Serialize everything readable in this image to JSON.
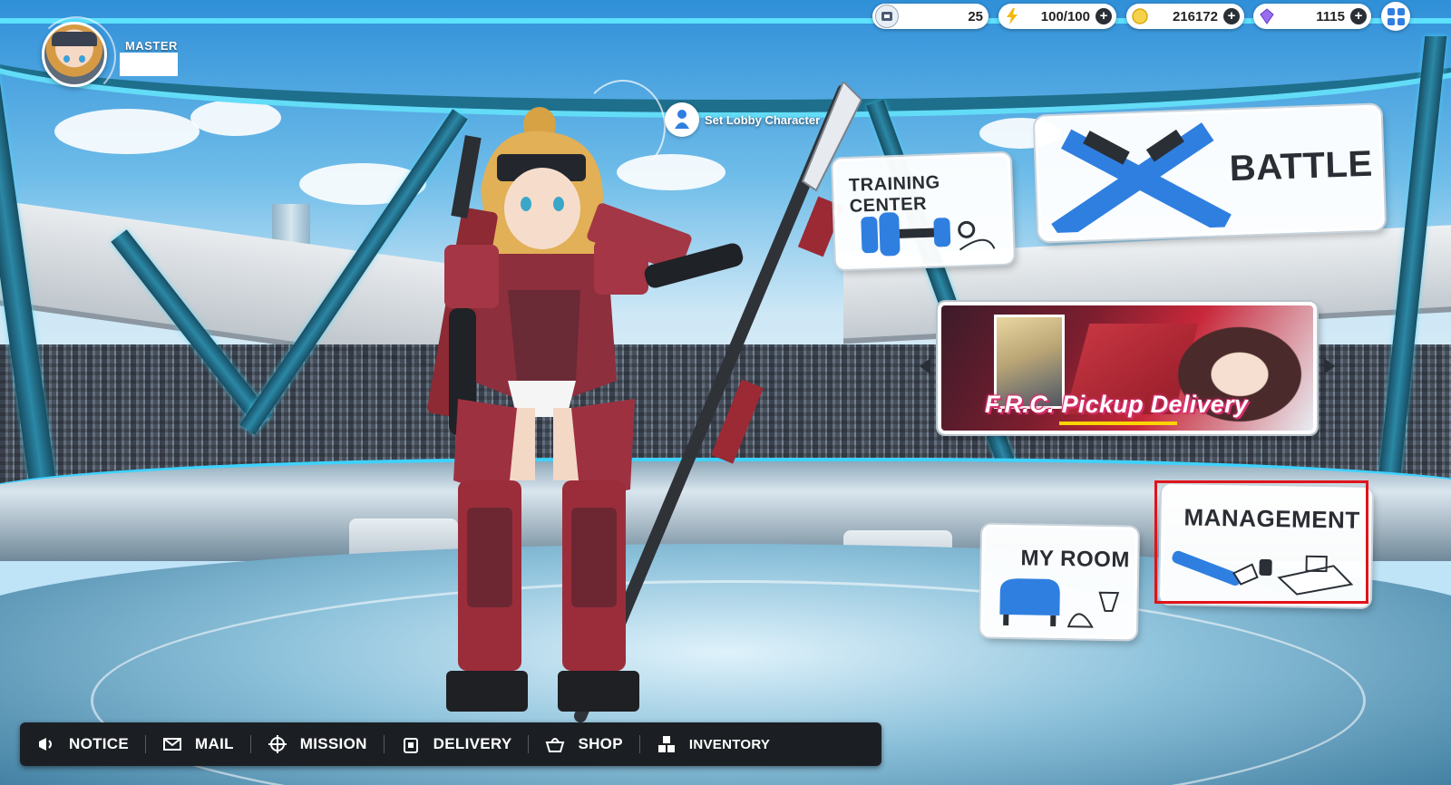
{
  "player": {
    "title": "MASTER",
    "name": ""
  },
  "currencies": [
    {
      "name": "ticket",
      "icon": "ticket-icon",
      "value": "25",
      "has_plus": false
    },
    {
      "name": "stamina",
      "icon": "lightning-icon",
      "value": "100/100",
      "has_plus": true
    },
    {
      "name": "coins",
      "icon": "coin-icon",
      "value": "216172",
      "has_plus": true
    },
    {
      "name": "gems",
      "icon": "gem-icon",
      "value": "1115",
      "has_plus": true
    }
  ],
  "lobby": {
    "set_character_label": "Set Lobby Character"
  },
  "menu": {
    "training_center": "TRAINING CENTER",
    "battle": "BATTLE",
    "my_room": "MY ROOM",
    "management": "MANAGEMENT"
  },
  "banner": {
    "title": "F.R.C. Pickup Delivery"
  },
  "bottom_nav": [
    {
      "label": "NOTICE",
      "icon": "megaphone-icon"
    },
    {
      "label": "MAIL",
      "icon": "envelope-icon"
    },
    {
      "label": "MISSION",
      "icon": "crosshair-icon"
    },
    {
      "label": "DELIVERY",
      "icon": "package-icon"
    },
    {
      "label": "SHOP",
      "icon": "basket-icon"
    },
    {
      "label": "INVENTORY",
      "icon": "boxes-icon"
    }
  ],
  "colors": {
    "accent_blue": "#2f7fe0",
    "highlight_red": "#e0141a",
    "nav_bg": "#1b1f24",
    "banner_pink": "#d6306c"
  }
}
